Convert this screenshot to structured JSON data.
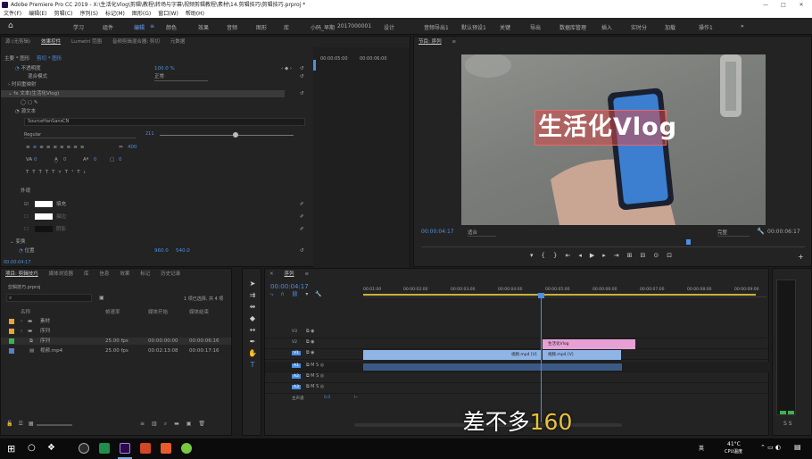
{
  "window": {
    "title": "Adobe Premiere Pro CC 2019 - X:\\生活化Vlog\\剪辑\\教程\\转场与字幕\\视频剪辑教程\\素材\\14.剪辑技巧\\剪辑技巧.prproj *"
  },
  "menu": [
    "文件(F)",
    "编辑(E)",
    "剪辑(C)",
    "序列(S)",
    "标记(M)",
    "图形(G)",
    "窗口(W)",
    "帮助(H)"
  ],
  "workspaces": [
    "学习",
    "组件",
    "编辑",
    "颜色",
    "效果",
    "音频",
    "图形",
    "库",
    "小码_早期",
    "2017000001",
    "设计",
    "音频导出1",
    "默认预设1",
    "关键",
    "导出",
    "数据库管理",
    "插入",
    "实时分",
    "加载",
    "操作1"
  ],
  "workspace_active": "编辑",
  "effect_controls": {
    "tabs": [
      "源:(无剪辑)",
      "效果控件",
      "Lumetri 范围",
      "音频剪辑混合器: 剪切",
      "元数据"
    ],
    "active_tab": "效果控件",
    "master_clip": "主要 * 图形",
    "sequence_clip": "剪切 * 图形",
    "rows": [
      {
        "label": "不透明度",
        "value": "100.0 %"
      },
      {
        "label": "混合模式",
        "value": "正常"
      },
      {
        "label": "时间重映射",
        "value": ""
      },
      {
        "label": "文本(生活化Vlog)",
        "value": ""
      },
      {
        "label": "源文本",
        "value": ""
      }
    ],
    "font_name": "SourceHanSansCN",
    "font_style": "Regular",
    "font_size": "211",
    "tracking": "400",
    "kerning": "0",
    "leading": "0",
    "baseline": "0",
    "tsume": "0",
    "appearance": "外观",
    "fill_label": "填充",
    "stroke_label": "描边",
    "shadow_label": "阴影",
    "transform_label": "变换",
    "position_label": "位置",
    "position_x": "960.0",
    "position_y": "540.0",
    "timecode": "00:00:04:17",
    "ruler": [
      "00:00:05:00",
      "00:00:06:00"
    ]
  },
  "program": {
    "title": "节目: 序列",
    "timecode": "00:00:04:17",
    "fit": "适合",
    "quality": "完整",
    "duration": "00:00:06:17",
    "overlay_text": "生活化Vlog"
  },
  "project": {
    "tabs": [
      "项目: 剪辑技巧",
      "媒体浏览器",
      "库",
      "信息",
      "效果",
      "标记",
      "历史记录"
    ],
    "active_tab": "项目: 剪辑技巧",
    "file": "剪辑技巧.prproj",
    "count": "1 项已选择, 共 4 项",
    "columns": [
      "名称",
      "帧速率",
      "媒体开始",
      "媒体结束"
    ],
    "items": [
      {
        "name": "素材",
        "fps": "",
        "start": "",
        "end": "",
        "color": "#e8a33a"
      },
      {
        "name": "序列",
        "fps": "",
        "start": "",
        "end": "",
        "color": "#e8a33a"
      },
      {
        "name": "序列",
        "fps": "25.00 fps",
        "start": "00:00:00:00",
        "end": "00:00:06:16",
        "color": "#3bb54a"
      },
      {
        "name": "视频.mp4",
        "fps": "25.00 fps",
        "start": "00:02:13:08",
        "end": "00:00:17:16",
        "color": "#5a7fc4"
      }
    ]
  },
  "timeline": {
    "tab": "序列",
    "timecode": "00:00:04:17",
    "ruler": [
      "00:01:00",
      "00:00:02:00",
      "00:00:03:00",
      "00:00:04:00",
      "00:00:05:00",
      "00:00:06:00",
      "00:00:07:00",
      "00:00:08:00",
      "00:00:09:00"
    ],
    "tracks": [
      "V3",
      "V2",
      "V1",
      "A1",
      "A2",
      "A3",
      "主声道"
    ],
    "master_value": "0.0",
    "clips": [
      {
        "label": "生活化Vlog",
        "track": "V2",
        "color": "#e7a0d6"
      },
      {
        "label": "视频.mp4 [V]",
        "track": "V1",
        "color": "#8fb4e6"
      },
      {
        "label": "视频.mp4 [V]",
        "track": "V1b",
        "color": "#8fb4e6"
      }
    ]
  },
  "subtitle": {
    "prefix": "差不多",
    "number": "160"
  },
  "taskbar": {
    "temp": "41°C",
    "cpu": "CPU温度",
    "lang": "英"
  }
}
